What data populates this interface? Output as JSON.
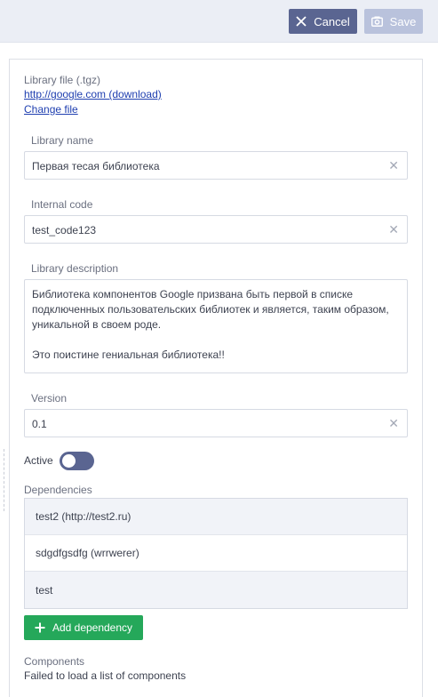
{
  "toolbar": {
    "cancel_label": "Cancel",
    "save_label": "Save"
  },
  "file": {
    "label": "Library file (.tgz)",
    "link": "http://google.com (download)",
    "change_label": "Change file"
  },
  "fields": {
    "name": {
      "label": "Library name",
      "value": "Первая тесая библиотека"
    },
    "code": {
      "label": "Internal code",
      "value": "test_code123"
    },
    "description": {
      "label": "Library description",
      "value": "Библиотека компонентов Google призвана быть первой в списке подключенных пользовательских библиотек и является, таким образом, уникальной в своем роде.\n\nЭто поистине гениальная библиотека!!"
    },
    "version": {
      "label": "Version",
      "value": "0.1"
    }
  },
  "active": {
    "label": "Active",
    "checked": false
  },
  "dependencies": {
    "label": "Dependencies",
    "items": [
      "test2 (http://test2.ru)",
      "sdgdfgsdfg (wrrwerer)",
      "test"
    ]
  },
  "add_dependency_label": "Add dependency",
  "components": {
    "label": "Components",
    "message": "Failed to load a list of components"
  },
  "colors": {
    "primary": "#5a6591",
    "primary_disabled": "#b9c2dc",
    "success": "#25a85a",
    "link": "#1f3fb0"
  }
}
